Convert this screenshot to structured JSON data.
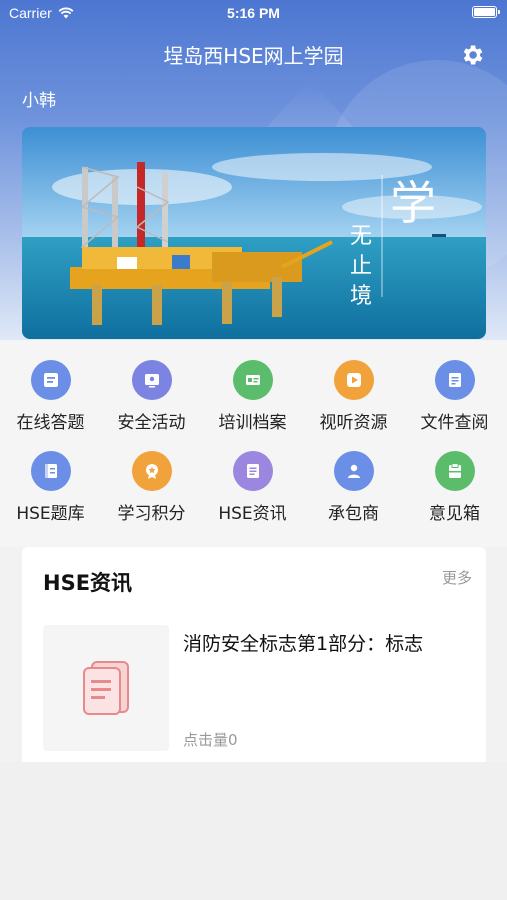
{
  "status_bar": {
    "carrier": "Carrier",
    "time": "5:16 PM"
  },
  "header": {
    "title": "埕岛西HSE网上学园",
    "username": "小韩"
  },
  "banner": {
    "calligraphy_main": "学",
    "calligraphy_sub": [
      "无",
      "止",
      "境"
    ]
  },
  "menu": [
    {
      "label": "在线答题",
      "icon": "answer-icon",
      "color": "#6b8ee6"
    },
    {
      "label": "安全活动",
      "icon": "safety-activity-icon",
      "color": "#7c84e2"
    },
    {
      "label": "培训档案",
      "icon": "training-record-icon",
      "color": "#5bbd6c"
    },
    {
      "label": "视听资源",
      "icon": "video-resource-icon",
      "color": "#f2a23a"
    },
    {
      "label": "文件查阅",
      "icon": "document-icon",
      "color": "#6b8ee6"
    },
    {
      "label": "HSE题库",
      "icon": "question-bank-icon",
      "color": "#6b8ee6"
    },
    {
      "label": "学习积分",
      "icon": "points-icon",
      "color": "#f2a23a"
    },
    {
      "label": "HSE资讯",
      "icon": "news-icon",
      "color": "#9b86e0"
    },
    {
      "label": "承包商",
      "icon": "contractor-icon",
      "color": "#6b8ee6"
    },
    {
      "label": "意见箱",
      "icon": "suggestion-box-icon",
      "color": "#5bbd6c"
    }
  ],
  "news": {
    "title": "HSE资讯",
    "more": "更多",
    "items": [
      {
        "headline": "消防安全标志第1部分：标志",
        "clicks": "点击量0"
      }
    ]
  }
}
